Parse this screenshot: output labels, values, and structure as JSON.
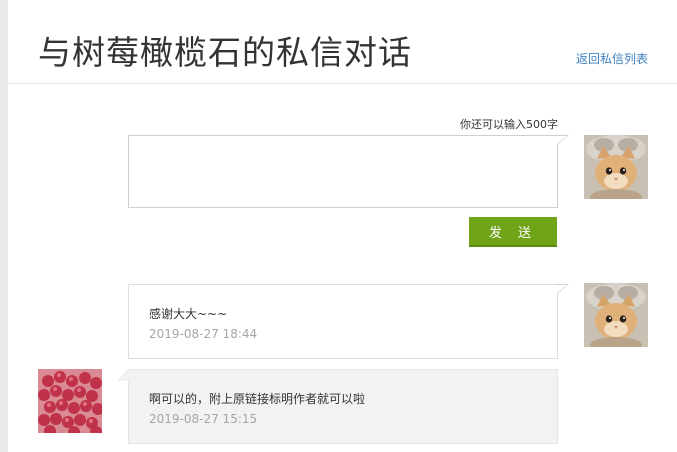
{
  "header": {
    "title": "与树莓橄榄石的私信对话",
    "back_link": "返回私信列表"
  },
  "composer": {
    "remaining": "你还可以输入500字",
    "value": "",
    "send_label": "发 送"
  },
  "messages": [
    {
      "side": "right",
      "author": "me",
      "text": "感谢大大~~~",
      "time": "2019-08-27 18:44"
    },
    {
      "side": "left",
      "author": "树莓橄榄石",
      "text": "啊可以的，附上原链接标明作者就可以啦",
      "time": "2019-08-27 15:15"
    }
  ],
  "colors": {
    "accent_button": "#6fa419",
    "link": "#3d7fbf",
    "timestamp": "#a6a6a6",
    "incoming_bubble": "#f2f2f2"
  },
  "icons": {
    "my_avatar": "kitten-avatar",
    "other_avatar": "raspberry-avatar"
  }
}
